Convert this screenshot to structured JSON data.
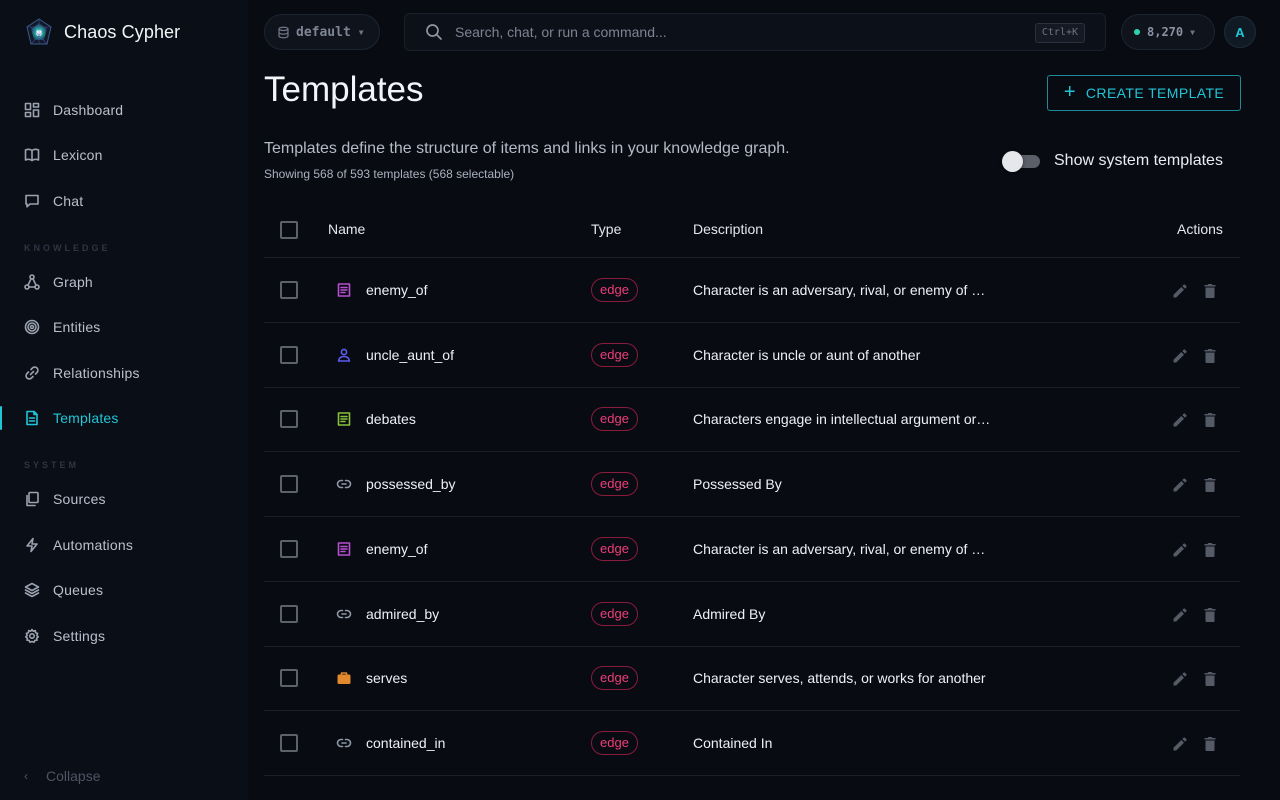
{
  "brand": {
    "name": "Chaos Cypher"
  },
  "sidebar": {
    "items": [
      {
        "label": "Dashboard",
        "icon": "dashboard-icon"
      },
      {
        "label": "Lexicon",
        "icon": "book-icon"
      },
      {
        "label": "Chat",
        "icon": "chat-icon"
      },
      {
        "label": "Graph",
        "icon": "graph-icon"
      },
      {
        "label": "Entities",
        "icon": "target-icon"
      },
      {
        "label": "Relationships",
        "icon": "link-icon"
      },
      {
        "label": "Templates",
        "icon": "file-icon",
        "active": true
      },
      {
        "label": "Sources",
        "icon": "sources-icon"
      },
      {
        "label": "Automations",
        "icon": "bolt-icon"
      },
      {
        "label": "Queues",
        "icon": "layers-icon"
      },
      {
        "label": "Settings",
        "icon": "gear-icon"
      }
    ],
    "sections": {
      "knowledge": "KNOWLEDGE",
      "system": "SYSTEM"
    },
    "collapse_label": "Collapse"
  },
  "topbar": {
    "workspace": "default",
    "search_placeholder": "Search, chat, or run a command...",
    "shortcut": "Ctrl+K",
    "credits": "8,270",
    "avatar_initial": "A"
  },
  "page": {
    "title": "Templates",
    "create_label": "CREATE TEMPLATE",
    "subtitle": "Templates define the structure of items and links in your knowledge graph.",
    "count_text": "Showing 568 of 593 templates (568 selectable)",
    "toggle_label": "Show system templates",
    "toggle_on": false
  },
  "table": {
    "columns": {
      "name": "Name",
      "type": "Type",
      "description": "Description",
      "actions": "Actions"
    },
    "rows": [
      {
        "name": "enemy_of",
        "type": "edge",
        "description": "Character is an adversary, rival, or enemy of another",
        "icon": "document-icon",
        "color": "#b64fd0"
      },
      {
        "name": "uncle_aunt_of",
        "type": "edge",
        "description": "Character is uncle or aunt of another",
        "icon": "person-icon",
        "color": "#5b5cf0"
      },
      {
        "name": "debates",
        "type": "edge",
        "description": "Characters engage in intellectual argument or discussion",
        "icon": "document-icon",
        "color": "#86c23a"
      },
      {
        "name": "possessed_by",
        "type": "edge",
        "description": "Possessed By",
        "icon": "link-icon",
        "color": "#8e97a6"
      },
      {
        "name": "enemy_of",
        "type": "edge",
        "description": "Character is an adversary, rival, or enemy of another",
        "icon": "document-icon",
        "color": "#b64fd0"
      },
      {
        "name": "admired_by",
        "type": "edge",
        "description": "Admired By",
        "icon": "link-icon",
        "color": "#8e97a6"
      },
      {
        "name": "serves",
        "type": "edge",
        "description": "Character serves, attends, or works for another",
        "icon": "briefcase-icon",
        "color": "#e0892e"
      },
      {
        "name": "contained_in",
        "type": "edge",
        "description": "Contained In",
        "icon": "link-icon",
        "color": "#8e97a6"
      }
    ]
  }
}
